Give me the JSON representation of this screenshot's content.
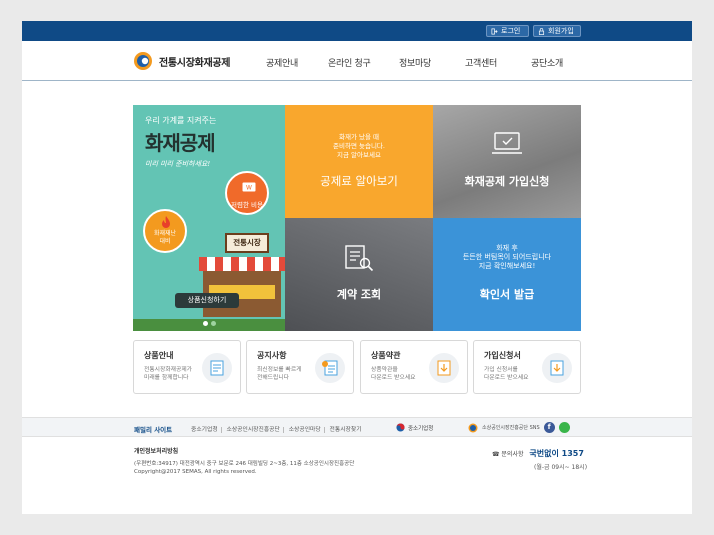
{
  "topbar": {
    "login": "로그인",
    "signup": "회원가입"
  },
  "header": {
    "logo_text": "전통시장화재공제",
    "nav": [
      "공제안내",
      "온라인 청구",
      "정보마당",
      "고객센터",
      "공단소개"
    ]
  },
  "hero": {
    "green": {
      "tagline": "우리 가계를 지켜주는",
      "title": "화재공제",
      "handwritten": "미리 미리 준비하세요!",
      "badge_cost": "저렴한 비용",
      "badge_fire_1": "화재재난",
      "badge_fire_2": "대비",
      "shop_sign": "전통시장",
      "product_btn": "상품신청하기"
    },
    "orange": {
      "line1": "화재가 났을 때",
      "line2": "준비하면 늦습니다.",
      "line3": "지금 알아보세요",
      "title": "공제료 알아보기"
    },
    "gray": {
      "title": "화재공제 가입신청"
    },
    "dark": {
      "title": "계약 조회"
    },
    "blue": {
      "line1": "화재 후",
      "line2": "든든한 버팀목이 되어드립니다",
      "line3": "지금 확인해보세요!",
      "title": "확인서 발급"
    }
  },
  "cards": [
    {
      "title": "상품안내",
      "desc1": "전통시장화재공제가",
      "desc2": "미래를 함께합니다"
    },
    {
      "title": "공지사항",
      "desc1": "최신정보를 빠르게",
      "desc2": "전해드립니다"
    },
    {
      "title": "상품약관",
      "desc1": "상품약관을",
      "desc2": "다운로드 받으세요"
    },
    {
      "title": "가입신청서",
      "desc1": "가입 신청서를",
      "desc2": "다운로드 받으세요"
    }
  ],
  "family": {
    "title": "패밀리 사이트",
    "links": [
      "중소기업청",
      "소상공인시장진흥공단",
      "소상공인마당",
      "전통시장찾기"
    ],
    "agency": "중소기업청",
    "sns_label": "소상공인시장진흥공단 SNS"
  },
  "footer": {
    "privacy": "개인정보처리방침",
    "address": "(우편번호:34917) 대전광역시 중구 보문로 246 대림빌딩 2~3층, 11층 소상공인시장진흥공단",
    "copyright": "Copyright@2017 SEMAS, All rights reserved.",
    "contact_label": "문의사항",
    "contact_number": "국번없이 1357",
    "hours": "(월-금 09시~ 18시)"
  },
  "colors": {
    "brand_blue": "#0f4a86",
    "orange": "#f9a72d",
    "green": "#63c4b4",
    "blue": "#3b93d8"
  }
}
